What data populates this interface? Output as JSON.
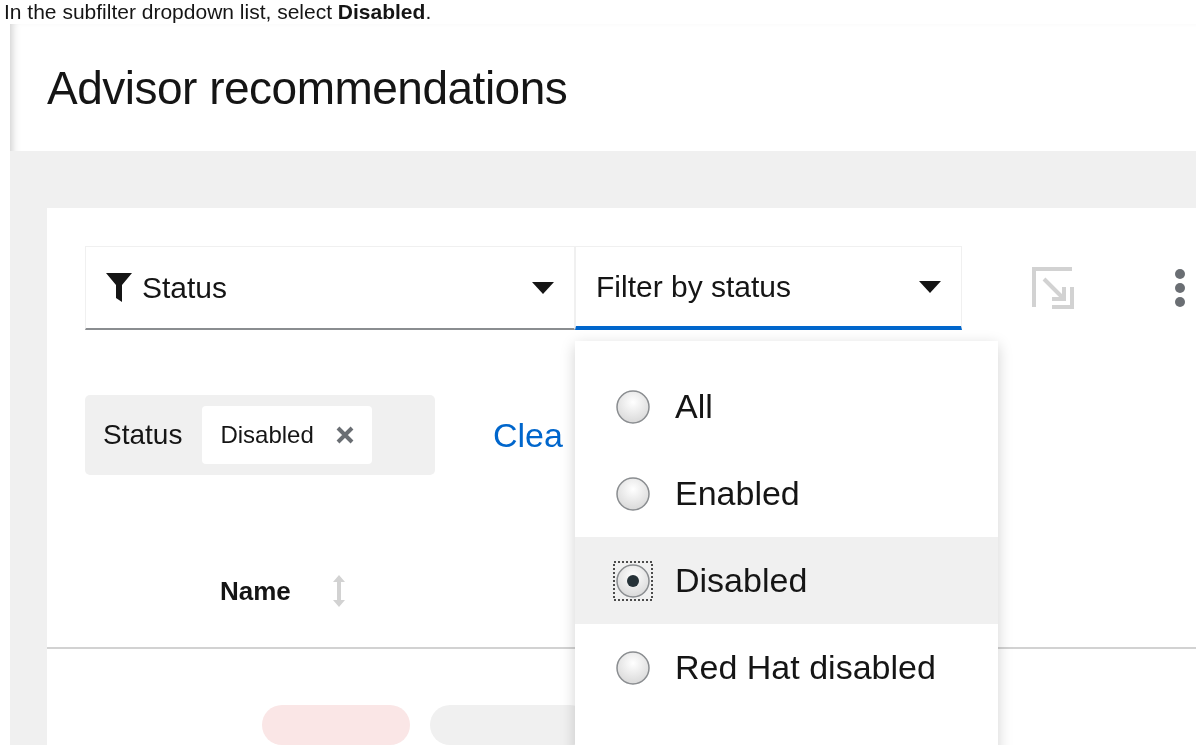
{
  "caption": "In the subfilter dropdown list, select **Disabled**.",
  "title": "Advisor recommendations",
  "toolbar": {
    "attribute_select": "Status",
    "value_select": "Filter by status",
    "value_select_expanded": true
  },
  "chips": {
    "category": "Status",
    "items": [
      "Disabled"
    ],
    "clear_link": "Clea"
  },
  "menu": [
    {
      "label": "All",
      "selected": false
    },
    {
      "label": "Enabled",
      "selected": false
    },
    {
      "label": "Disabled",
      "selected": true
    },
    {
      "label": "Red Hat disabled",
      "selected": false
    }
  ],
  "table": {
    "columns": [
      "Name"
    ]
  }
}
